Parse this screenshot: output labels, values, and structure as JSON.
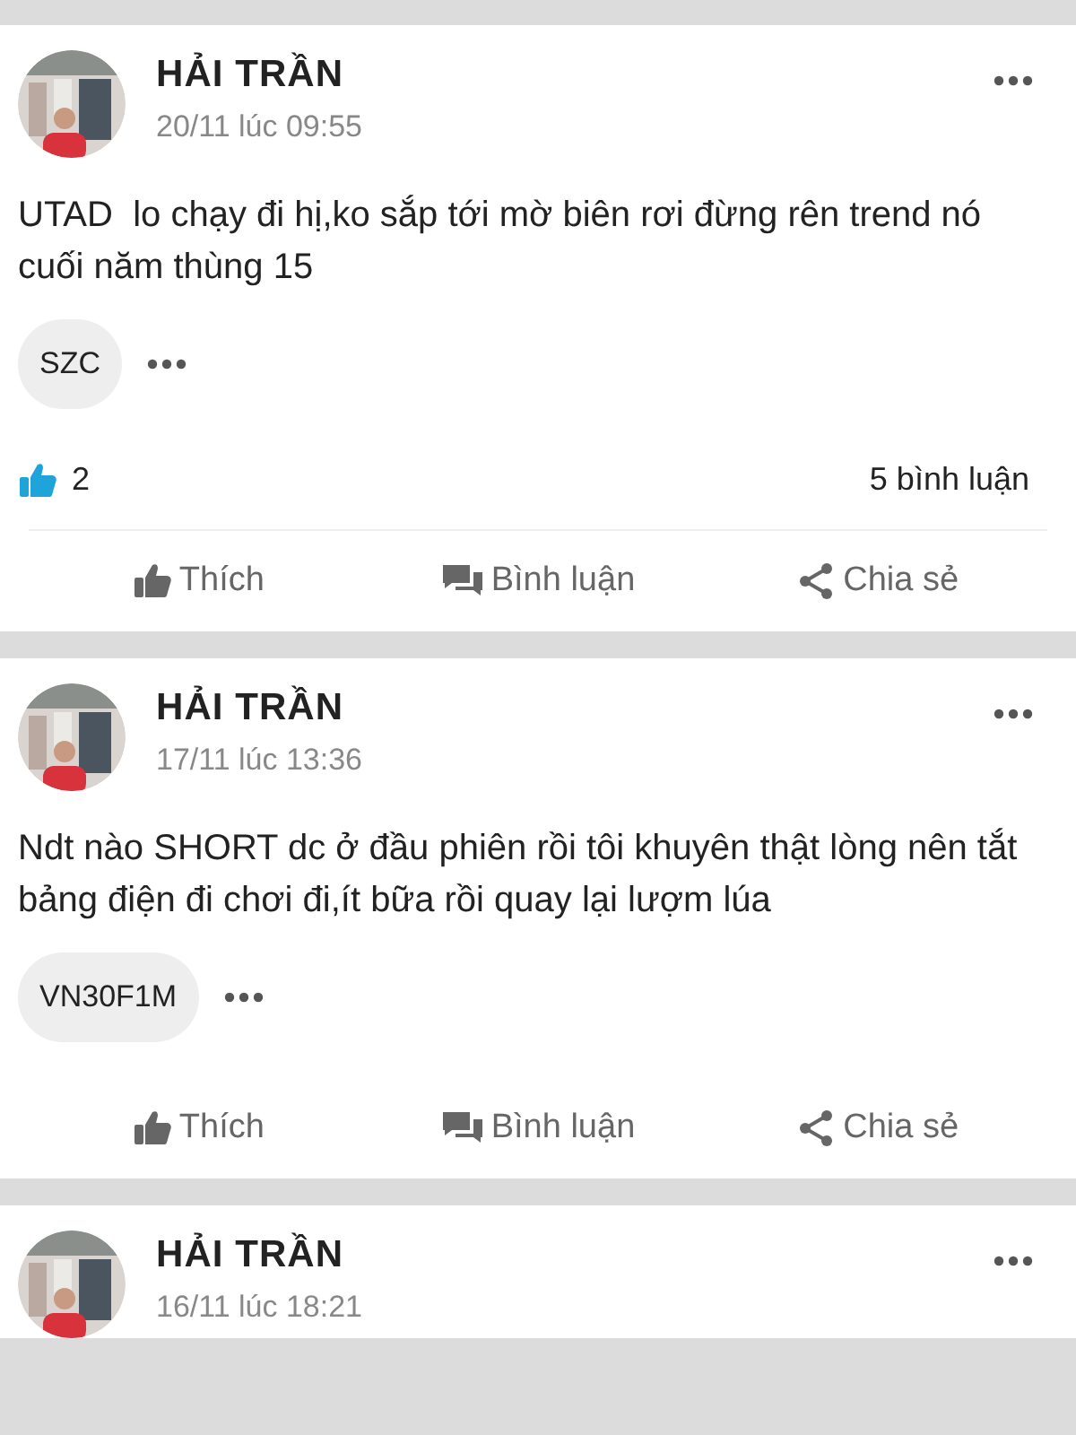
{
  "posts": [
    {
      "author": "HẢI TRẦN",
      "time": "20/11 lúc 09:55",
      "text": "UTAD  lo chạy đi hị,ko sắp tới mờ biên rơi đừng rên trend nó cuối năm thùng 15",
      "tags": [
        "SZC"
      ],
      "stats": {
        "likes": "2",
        "comments": "5 bình luận"
      },
      "actions": [
        {
          "kind": "like",
          "label": "Thích"
        },
        {
          "kind": "comment",
          "label": "Bình luận"
        },
        {
          "kind": "share",
          "label": "Chia sẻ"
        }
      ]
    },
    {
      "author": "HẢI TRẦN",
      "time": "17/11 lúc 13:36",
      "text": "Ndt nào SHORT dc ở đầu phiên rồi tôi khuyên thật lòng nên tắt bảng điện đi chơi đi,ít bữa rồi quay lại lượm lúa",
      "tags": [
        "VN30F1M"
      ],
      "actions": [
        {
          "kind": "like",
          "label": "Thích"
        },
        {
          "kind": "comment",
          "label": "Bình luận"
        },
        {
          "kind": "share",
          "label": "Chia sẻ"
        }
      ]
    },
    {
      "author": "HẢI TRẦN",
      "time": "16/11 lúc 18:21"
    }
  ]
}
